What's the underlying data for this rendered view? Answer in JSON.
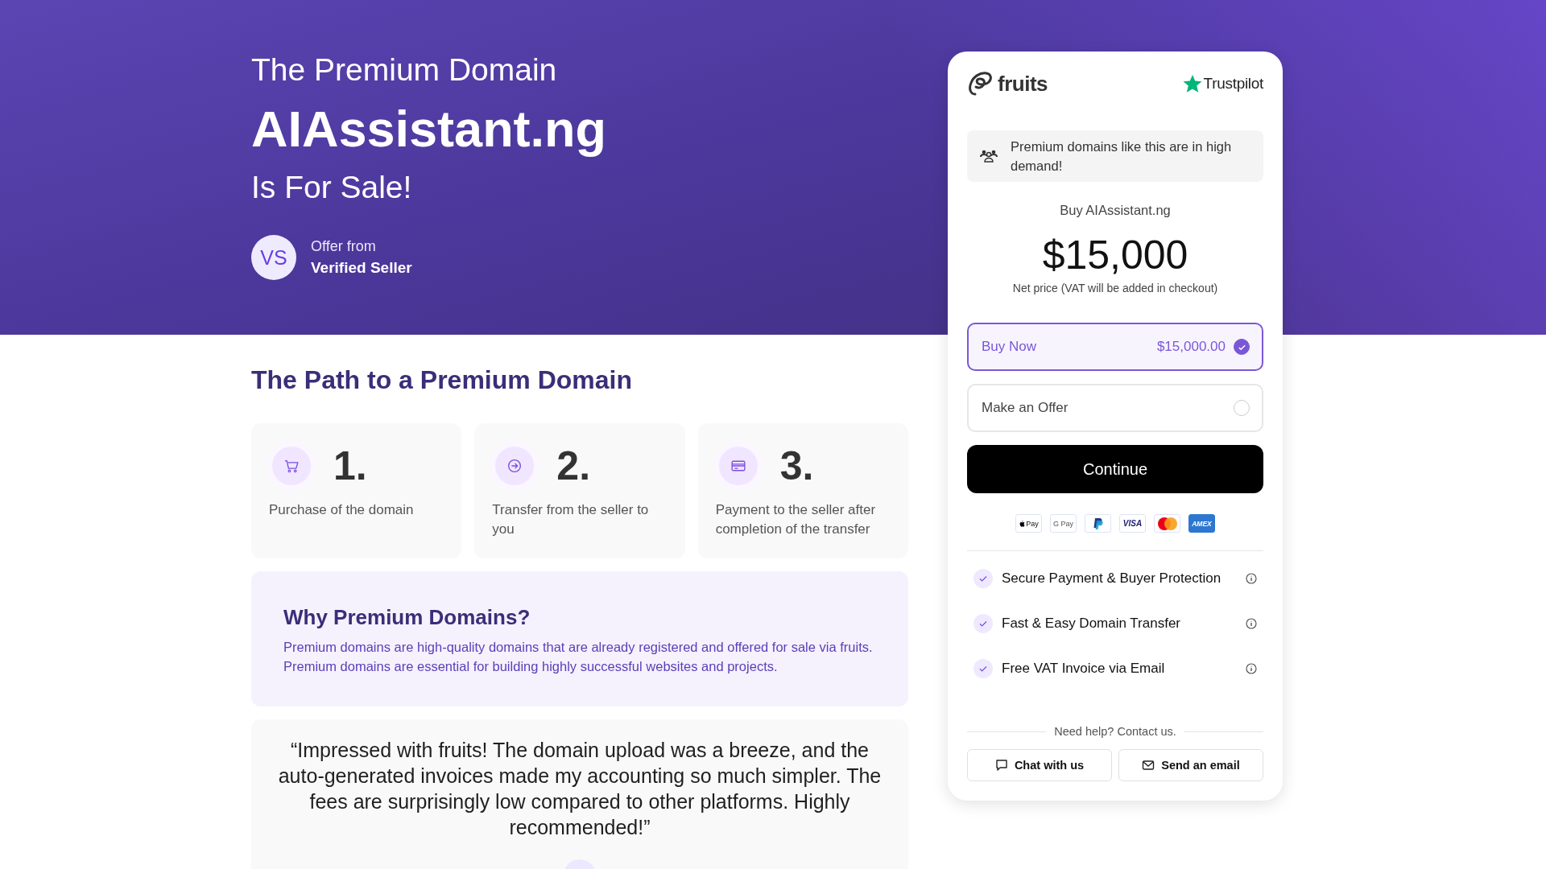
{
  "hero": {
    "eyebrow": "The Premium Domain",
    "domain": "AIAssistant.ng",
    "tagline": "Is For Sale!",
    "seller": {
      "initials": "VS",
      "caption": "Offer from",
      "name": "Verified Seller"
    }
  },
  "path": {
    "title": "The Path to a Premium Domain",
    "steps": [
      {
        "kind": "cart",
        "number": "1.",
        "text": "Purchase of the domain"
      },
      {
        "kind": "transfer",
        "number": "2.",
        "text": "Transfer from the seller to you"
      },
      {
        "kind": "payment",
        "number": "3.",
        "text": "Payment to the seller after completion of the transfer"
      }
    ]
  },
  "why": {
    "title": "Why Premium Domains?",
    "text": "Premium domains are high-quality domains that are already registered and offered for sale via fruits. Premium domains are essential for building highly successful websites and projects."
  },
  "testimonial": {
    "quote": "“Impressed with fruits! The domain upload was a breeze, and the auto-generated invoices made my accounting so much simpler. The fees are surprisingly low compared to other platforms. Highly recommended!”"
  },
  "checkout": {
    "brand": "fruits",
    "rating_site": "Trustpilot",
    "notice": "Premium domains like this are in high demand!",
    "heading": "Buy AIAssistant.ng",
    "price": "$15,000",
    "price_note": "Net price (VAT will be added in checkout)",
    "options": [
      {
        "label": "Buy Now",
        "amount": "$15,000.00",
        "selected": true
      },
      {
        "label": "Make an Offer",
        "selected": false
      }
    ],
    "continue": "Continue",
    "payment_methods": [
      {
        "kind": "applepay",
        "label": "Pay"
      },
      {
        "kind": "googlepay",
        "label": "G Pay"
      },
      {
        "kind": "paypal"
      },
      {
        "kind": "visa",
        "label": "VISA"
      },
      {
        "kind": "mastercard"
      },
      {
        "kind": "amex",
        "label": "AMEX"
      }
    ],
    "features": [
      {
        "label": "Secure Payment & Buyer Protection"
      },
      {
        "label": "Fast & Easy Domain Transfer"
      },
      {
        "label": "Free VAT Invoice via Email"
      }
    ],
    "help": "Need help? Contact us.",
    "contact_buttons": [
      {
        "kind": "chat",
        "label": "Chat with us"
      },
      {
        "kind": "email",
        "label": "Send an email"
      }
    ]
  }
}
